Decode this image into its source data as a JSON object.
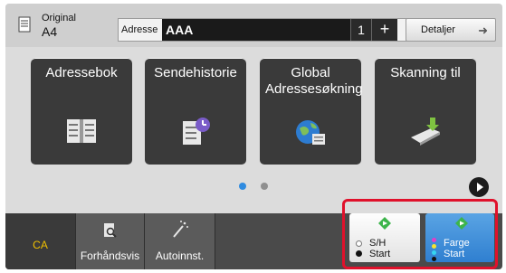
{
  "header": {
    "original_label": "Original",
    "original_size": "A4",
    "address_label": "Adresse",
    "address_value": "AAA",
    "address_count": "1",
    "add_symbol": "+",
    "details_label": "Detaljer"
  },
  "tiles": [
    {
      "label": "Adressebok",
      "icon": "address-book-icon"
    },
    {
      "label": "Sendehistorie",
      "icon": "send-history-icon"
    },
    {
      "label": "Global Adressesøkning",
      "icon": "global-address-search-icon"
    },
    {
      "label": "Skanning til",
      "icon": "scan-to-icon"
    }
  ],
  "pager": {
    "active_page": 1,
    "page_count": 2,
    "next_icon": "next-page-icon"
  },
  "bottom": {
    "ca_label": "CA",
    "preview_label": "Forhåndsvis",
    "auto_label": "Autoinnst.",
    "bw_line1": "S/H",
    "bw_line2": "Start",
    "color_line1": "Farge",
    "color_line2": "Start"
  },
  "colors": {
    "highlight": "#e0112b",
    "ca_text": "#f0c000",
    "start_diamond": "#3cb44b",
    "color_start_bg": "#3a8ad8",
    "page_dot_active": "#2f8be0"
  }
}
